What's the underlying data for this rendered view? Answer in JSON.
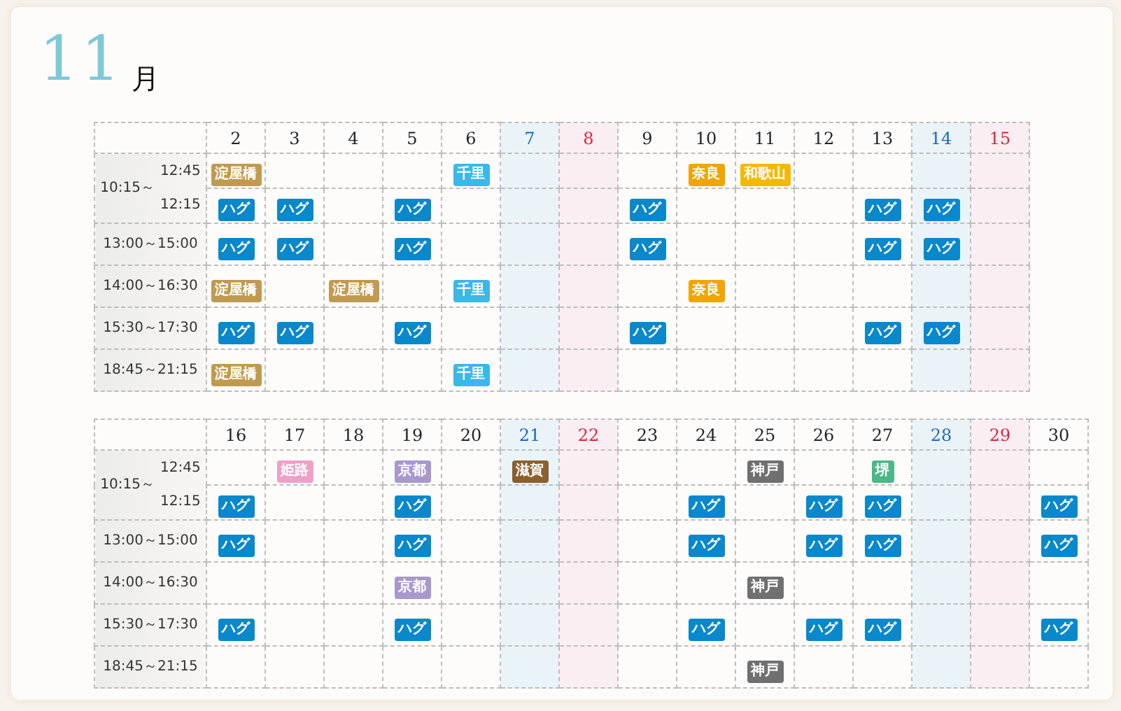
{
  "month": {
    "number": "11",
    "unit": "月"
  },
  "blocks": [
    {
      "days": [
        {
          "label": "2",
          "kind": "weekday"
        },
        {
          "label": "3",
          "kind": "weekday"
        },
        {
          "label": "4",
          "kind": "weekday"
        },
        {
          "label": "5",
          "kind": "weekday"
        },
        {
          "label": "6",
          "kind": "weekday"
        },
        {
          "label": "7",
          "kind": "saturday"
        },
        {
          "label": "8",
          "kind": "sunday"
        },
        {
          "label": "9",
          "kind": "weekday"
        },
        {
          "label": "10",
          "kind": "weekday"
        },
        {
          "label": "11",
          "kind": "weekday"
        },
        {
          "label": "12",
          "kind": "weekday"
        },
        {
          "label": "13",
          "kind": "weekday"
        },
        {
          "label": "14",
          "kind": "saturday"
        },
        {
          "label": "15",
          "kind": "sunday"
        }
      ],
      "rows": [
        {
          "time_group": {
            "start": "10:15～",
            "ends": [
              "12:45",
              "12:15"
            ]
          },
          "cells": [
            {
              "text": "淀屋橋",
              "color": "#c09a50"
            },
            null,
            null,
            null,
            {
              "text": "千里",
              "color": "#3bb8e8"
            },
            null,
            null,
            null,
            {
              "text": "奈良",
              "color": "#f0a500"
            },
            {
              "text": "和歌山",
              "color": "#f5b800"
            },
            null,
            null,
            null,
            null
          ]
        },
        {
          "cells": [
            {
              "text": "ハグ",
              "color": "#0a88cc"
            },
            {
              "text": "ハグ",
              "color": "#0a88cc"
            },
            null,
            {
              "text": "ハグ",
              "color": "#0a88cc"
            },
            null,
            null,
            null,
            {
              "text": "ハグ",
              "color": "#0a88cc"
            },
            null,
            null,
            null,
            {
              "text": "ハグ",
              "color": "#0a88cc"
            },
            {
              "text": "ハグ",
              "color": "#0a88cc"
            },
            null
          ]
        },
        {
          "time": "13:00～15:00",
          "cells": [
            {
              "text": "ハグ",
              "color": "#0a88cc"
            },
            {
              "text": "ハグ",
              "color": "#0a88cc"
            },
            null,
            {
              "text": "ハグ",
              "color": "#0a88cc"
            },
            null,
            null,
            null,
            {
              "text": "ハグ",
              "color": "#0a88cc"
            },
            null,
            null,
            null,
            {
              "text": "ハグ",
              "color": "#0a88cc"
            },
            {
              "text": "ハグ",
              "color": "#0a88cc"
            },
            null
          ]
        },
        {
          "time": "14:00～16:30",
          "cells": [
            {
              "text": "淀屋橋",
              "color": "#c09a50"
            },
            null,
            {
              "text": "淀屋橋",
              "color": "#c09a50"
            },
            null,
            {
              "text": "千里",
              "color": "#3bb8e8"
            },
            null,
            null,
            null,
            {
              "text": "奈良",
              "color": "#f0a500"
            },
            null,
            null,
            null,
            null,
            null
          ]
        },
        {
          "time": "15:30～17:30",
          "cells": [
            {
              "text": "ハグ",
              "color": "#0a88cc"
            },
            {
              "text": "ハグ",
              "color": "#0a88cc"
            },
            null,
            {
              "text": "ハグ",
              "color": "#0a88cc"
            },
            null,
            null,
            null,
            {
              "text": "ハグ",
              "color": "#0a88cc"
            },
            null,
            null,
            null,
            {
              "text": "ハグ",
              "color": "#0a88cc"
            },
            {
              "text": "ハグ",
              "color": "#0a88cc"
            },
            null
          ]
        },
        {
          "time": "18:45～21:15",
          "cells": [
            {
              "text": "淀屋橋",
              "color": "#c09a50"
            },
            null,
            null,
            null,
            {
              "text": "千里",
              "color": "#3bb8e8"
            },
            null,
            null,
            null,
            null,
            null,
            null,
            null,
            null,
            null
          ]
        }
      ]
    },
    {
      "days": [
        {
          "label": "16",
          "kind": "weekday"
        },
        {
          "label": "17",
          "kind": "weekday"
        },
        {
          "label": "18",
          "kind": "weekday"
        },
        {
          "label": "19",
          "kind": "weekday"
        },
        {
          "label": "20",
          "kind": "weekday"
        },
        {
          "label": "21",
          "kind": "saturday"
        },
        {
          "label": "22",
          "kind": "sunday"
        },
        {
          "label": "23",
          "kind": "weekday"
        },
        {
          "label": "24",
          "kind": "weekday"
        },
        {
          "label": "25",
          "kind": "weekday"
        },
        {
          "label": "26",
          "kind": "weekday"
        },
        {
          "label": "27",
          "kind": "weekday"
        },
        {
          "label": "28",
          "kind": "saturday"
        },
        {
          "label": "29",
          "kind": "sunday"
        },
        {
          "label": "30",
          "kind": "weekday"
        }
      ],
      "rows": [
        {
          "time_group": {
            "start": "10:15～",
            "ends": [
              "12:45",
              "12:15"
            ]
          },
          "cells": [
            null,
            {
              "text": "姫路",
              "color": "#f0a0c8"
            },
            null,
            {
              "text": "京都",
              "color": "#a898cc"
            },
            null,
            {
              "text": "滋賀",
              "color": "#8a6030"
            },
            null,
            null,
            null,
            {
              "text": "神戸",
              "color": "#707070"
            },
            null,
            {
              "text": "堺",
              "color": "#4cb888"
            },
            null,
            null,
            null
          ]
        },
        {
          "cells": [
            {
              "text": "ハグ",
              "color": "#0a88cc"
            },
            null,
            null,
            {
              "text": "ハグ",
              "color": "#0a88cc"
            },
            null,
            null,
            null,
            null,
            {
              "text": "ハグ",
              "color": "#0a88cc"
            },
            null,
            {
              "text": "ハグ",
              "color": "#0a88cc"
            },
            {
              "text": "ハグ",
              "color": "#0a88cc"
            },
            null,
            null,
            {
              "text": "ハグ",
              "color": "#0a88cc"
            }
          ]
        },
        {
          "time": "13:00～15:00",
          "cells": [
            {
              "text": "ハグ",
              "color": "#0a88cc"
            },
            null,
            null,
            {
              "text": "ハグ",
              "color": "#0a88cc"
            },
            null,
            null,
            null,
            null,
            {
              "text": "ハグ",
              "color": "#0a88cc"
            },
            null,
            {
              "text": "ハグ",
              "color": "#0a88cc"
            },
            {
              "text": "ハグ",
              "color": "#0a88cc"
            },
            null,
            null,
            {
              "text": "ハグ",
              "color": "#0a88cc"
            }
          ]
        },
        {
          "time": "14:00～16:30",
          "cells": [
            null,
            null,
            null,
            {
              "text": "京都",
              "color": "#a898cc"
            },
            null,
            null,
            null,
            null,
            null,
            {
              "text": "神戸",
              "color": "#707070"
            },
            null,
            null,
            null,
            null,
            null
          ]
        },
        {
          "time": "15:30～17:30",
          "cells": [
            {
              "text": "ハグ",
              "color": "#0a88cc"
            },
            null,
            null,
            {
              "text": "ハグ",
              "color": "#0a88cc"
            },
            null,
            null,
            null,
            null,
            {
              "text": "ハグ",
              "color": "#0a88cc"
            },
            null,
            {
              "text": "ハグ",
              "color": "#0a88cc"
            },
            {
              "text": "ハグ",
              "color": "#0a88cc"
            },
            null,
            null,
            {
              "text": "ハグ",
              "color": "#0a88cc"
            }
          ]
        },
        {
          "time": "18:45～21:15",
          "cells": [
            null,
            null,
            null,
            null,
            null,
            null,
            null,
            null,
            null,
            {
              "text": "神戸",
              "color": "#707070"
            },
            null,
            null,
            null,
            null,
            null
          ]
        }
      ]
    }
  ]
}
